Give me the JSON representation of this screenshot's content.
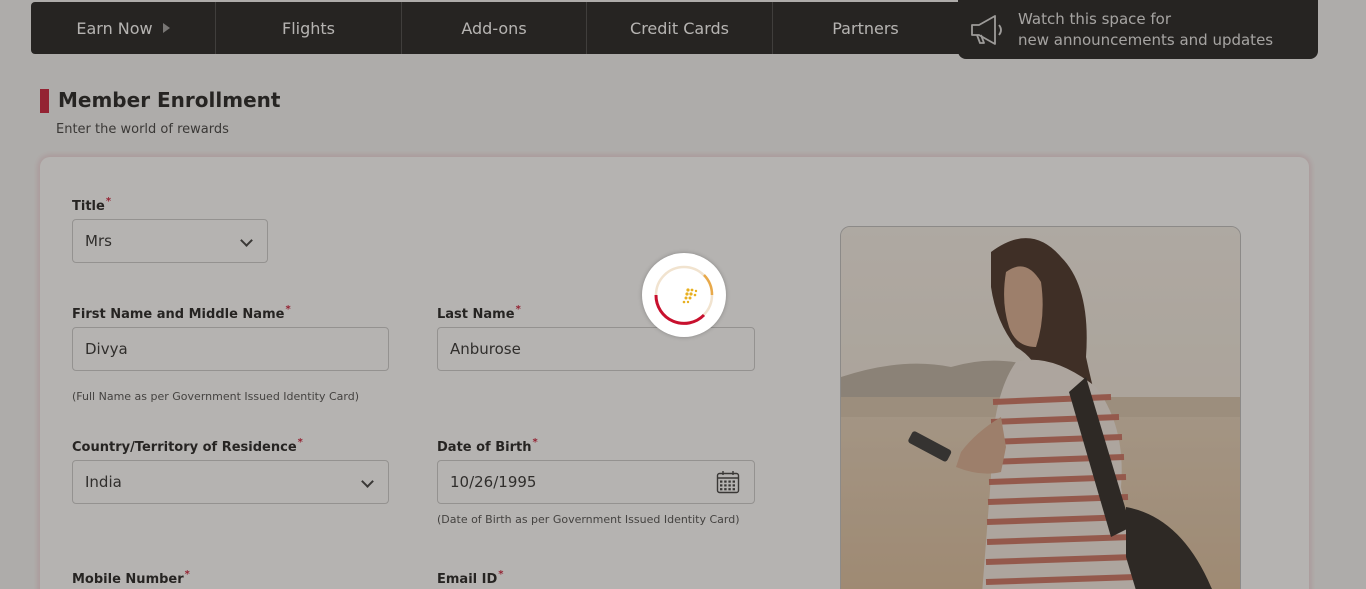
{
  "nav": {
    "earn_now": "Earn Now",
    "flights": "Flights",
    "addons": "Add-ons",
    "credit_cards": "Credit Cards",
    "partners": "Partners"
  },
  "announcement": {
    "line1": "Watch this space for",
    "line2": "new announcements and updates",
    "icon": "megaphone-icon"
  },
  "page": {
    "title": "Member Enrollment",
    "subtitle": "Enter the world of rewards"
  },
  "form": {
    "required_mark": "*",
    "title": {
      "label": "Title",
      "value": "Mrs"
    },
    "first_name": {
      "label": "First Name and Middle Name",
      "value": "Divya",
      "hint": "(Full Name as per Government Issued Identity Card)"
    },
    "last_name": {
      "label": "Last Name",
      "value": "Anburose"
    },
    "country": {
      "label": "Country/Territory of Residence",
      "value": "India"
    },
    "dob": {
      "label": "Date of Birth",
      "value": "10/26/1995",
      "hint": "(Date of Birth as per Government Issued Identity Card)"
    },
    "mobile": {
      "label": "Mobile Number"
    },
    "email": {
      "label": "Email ID"
    }
  },
  "colors": {
    "accent": "#c8102e",
    "nav_bg": "#121212",
    "spinner_gold": "#e8b020"
  }
}
